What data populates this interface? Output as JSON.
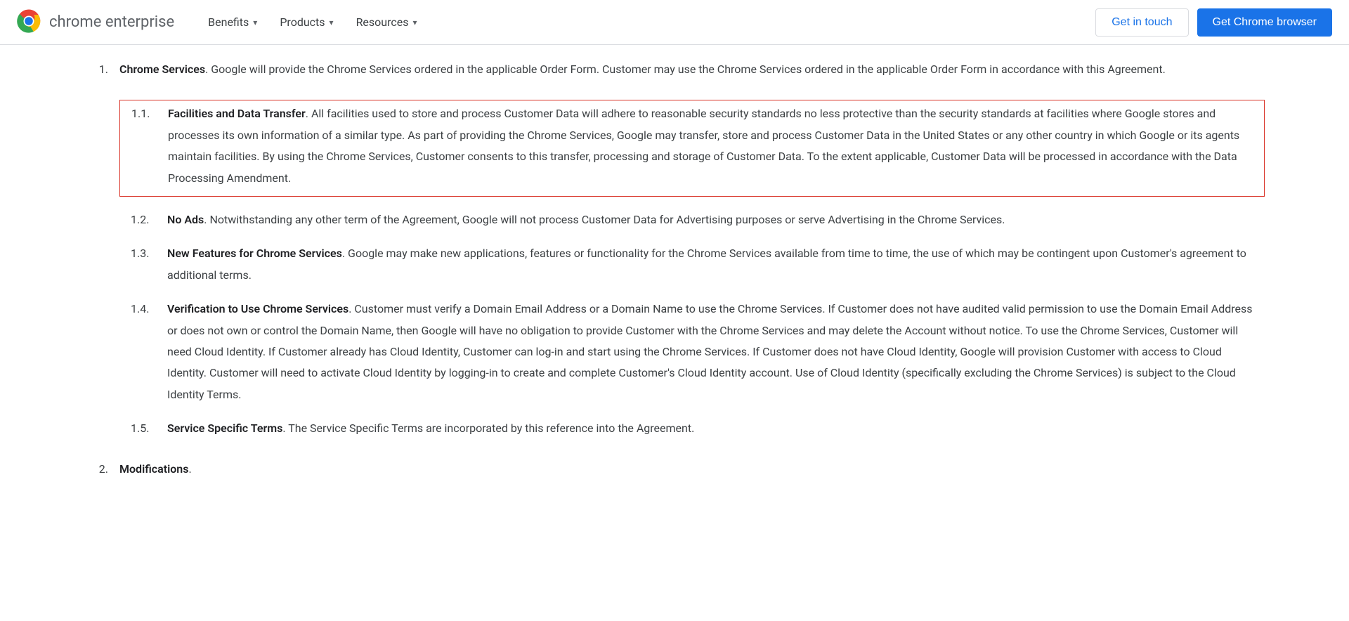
{
  "header": {
    "logo_text": "chrome enterprise",
    "nav": {
      "benefits": "Benefits",
      "products": "Products",
      "resources": "Resources"
    },
    "get_in_touch": "Get in touch",
    "get_chrome": "Get Chrome browser"
  },
  "sections": {
    "s1": {
      "num": "1.",
      "title": "Chrome Services",
      "text": ". Google will provide the Chrome Services ordered in the applicable Order Form. Customer may use the Chrome Services ordered in the applicable Order Form in accordance with this Agreement.",
      "sub": {
        "s11": {
          "num": "1.1.",
          "title": "Facilities and Data Transfer",
          "text": ". All facilities used to store and process Customer Data will adhere to reasonable security standards no less protective than the security standards at facilities where Google stores and processes its own information of a similar type. As part of providing the Chrome Services, Google may transfer, store and process Customer Data in the United States or any other country in which Google or its agents maintain facilities. By using the Chrome Services, Customer consents to this transfer, processing and storage of Customer Data. To the extent applicable, Customer Data will be processed in accordance with the Data Processing Amendment."
        },
        "s12": {
          "num": "1.2.",
          "title": "No Ads",
          "text": ". Notwithstanding any other term of the Agreement, Google will not process Customer Data for Advertising purposes or serve Advertising in the Chrome Services."
        },
        "s13": {
          "num": "1.3.",
          "title": "New Features for Chrome Services",
          "text": ". Google may make new applications, features or functionality for the Chrome Services available from time to time, the use of which may be contingent upon Customer's agreement to additional terms."
        },
        "s14": {
          "num": "1.4.",
          "title": "Verification to Use Chrome Services",
          "text": ". Customer must verify a Domain Email Address or a Domain Name to use the Chrome Services. If Customer does not have audited valid permission to use the Domain Email Address or does not own or control the Domain Name, then Google will have no obligation to provide Customer with the Chrome Services and may delete the Account without notice. To use the Chrome Services, Customer will need Cloud Identity. If Customer already has Cloud Identity, Customer can log-in and start using the Chrome Services. If Customer does not have Cloud Identity, Google will provision Customer with access to Cloud Identity. Customer will need to activate Cloud Identity by logging-in to create and complete Customer's Cloud Identity account. Use of Cloud Identity (specifically excluding the Chrome Services) is subject to the Cloud Identity Terms."
        },
        "s15": {
          "num": "1.5.",
          "title": "Service Specific Terms",
          "text": ". The Service Specific Terms are incorporated by this reference into the Agreement."
        }
      }
    },
    "s2": {
      "num": "2.",
      "title": "Modifications",
      "text": "."
    }
  }
}
